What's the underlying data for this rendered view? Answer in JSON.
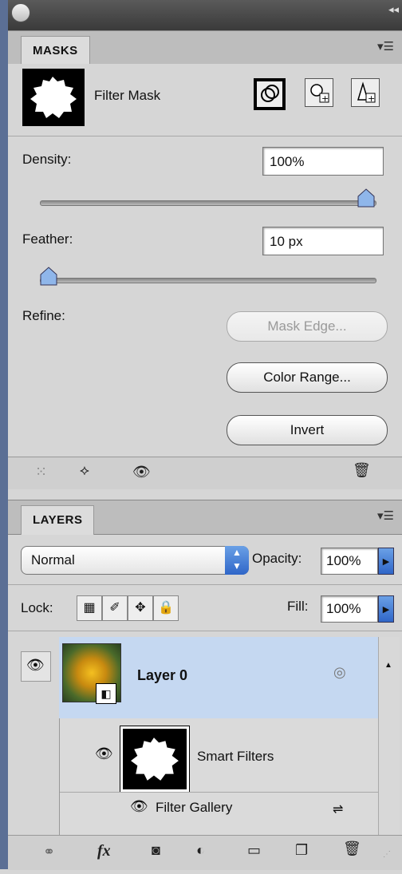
{
  "masks_panel": {
    "tab_label": "MASKS",
    "mask_title": "Filter Mask",
    "density_label": "Density:",
    "density_value": "100%",
    "density_level": 1.0,
    "feather_label": "Feather:",
    "feather_value": "10 px",
    "feather_level": 0.0,
    "refine_label": "Refine:",
    "mask_edge_button": "Mask Edge...",
    "color_range_button": "Color Range...",
    "invert_button": "Invert"
  },
  "layers_panel": {
    "tab_label": "LAYERS",
    "blend_mode": "Normal",
    "opacity_label": "Opacity:",
    "opacity_value": "100%",
    "lock_label": "Lock:",
    "fill_label": "Fill:",
    "fill_value": "100%",
    "layer_name": "Layer 0",
    "smart_filters_label": "Smart Filters",
    "filter_item_label": "Filter Gallery",
    "fx_label": "fx"
  },
  "colors": {
    "selected_row": "#c5d8f1",
    "accent_blue": "#2f66c8",
    "panel_bg": "#d6d6d6"
  }
}
